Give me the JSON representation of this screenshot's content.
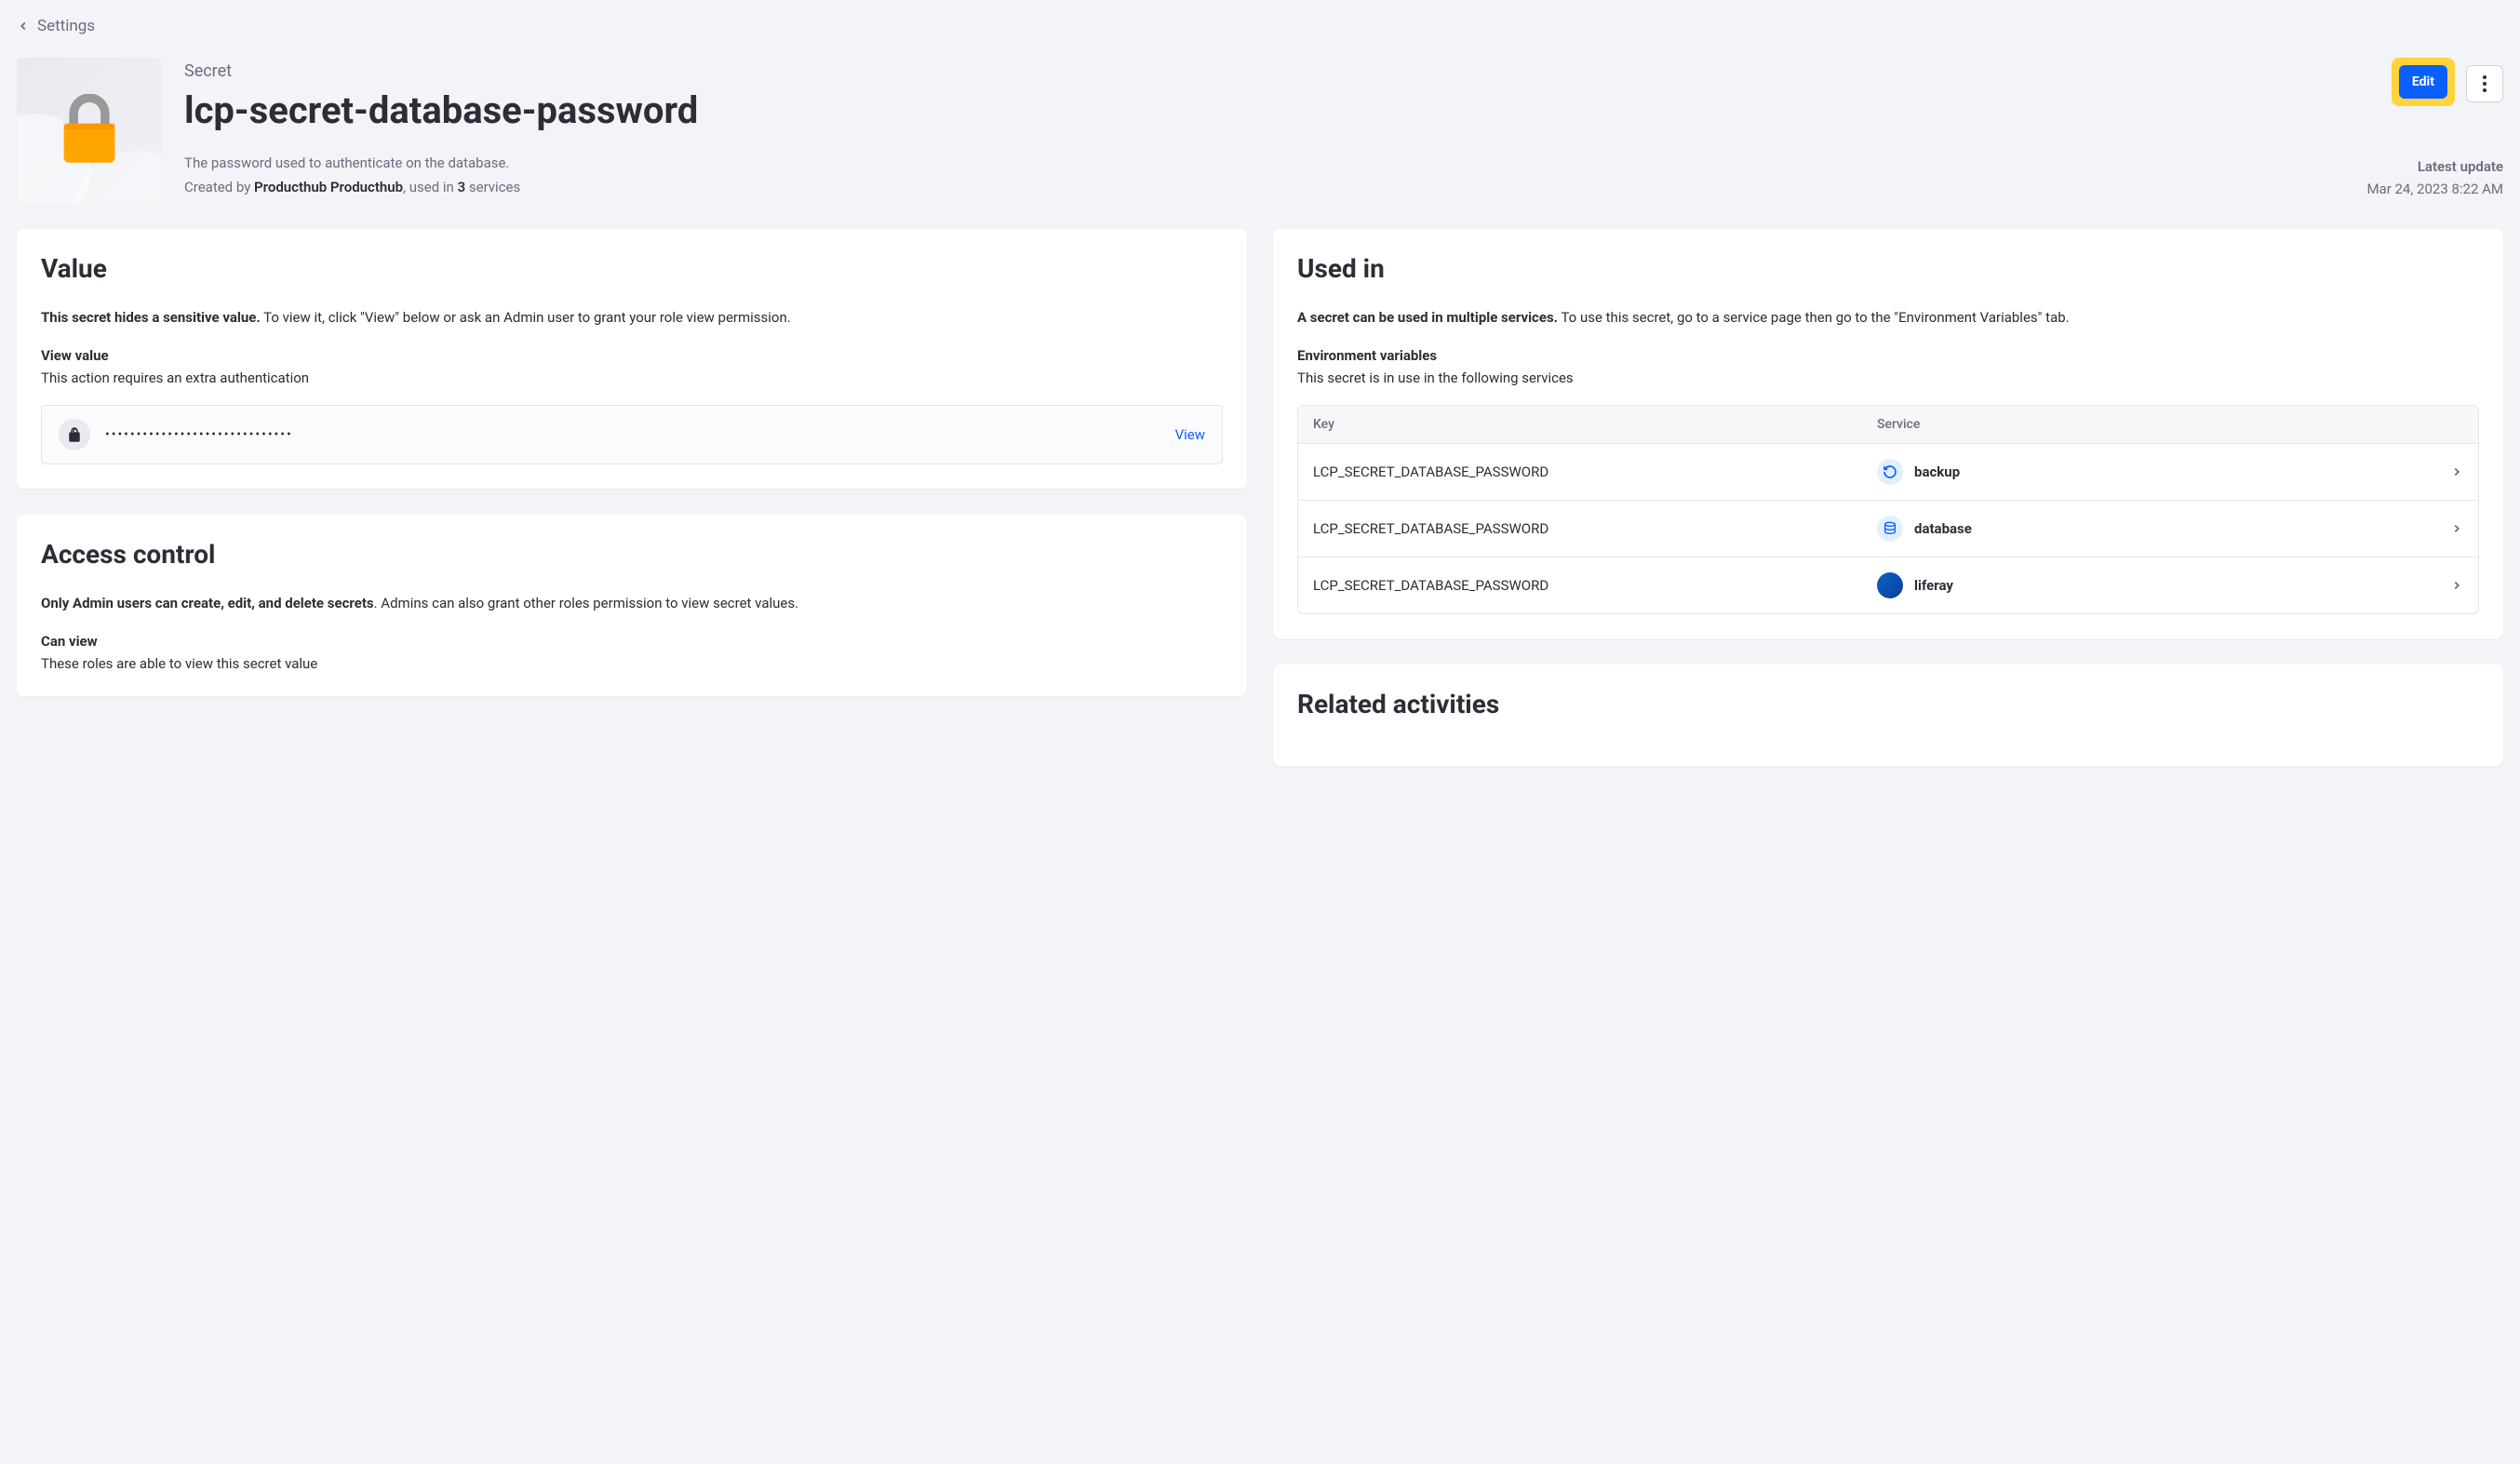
{
  "breadcrumb": {
    "label": "Settings"
  },
  "header": {
    "eyebrow": "Secret",
    "title": "lcp-secret-database-password",
    "description": "The password used to authenticate on the database.",
    "created_prefix": "Created by ",
    "created_author": "Producthub Producthub",
    "created_mid": ", used in ",
    "created_count": "3",
    "created_suffix": " services",
    "edit_label": "Edit",
    "latest_label": "Latest update",
    "latest_date": "Mar 24, 2023 8:22 AM"
  },
  "value_card": {
    "heading": "Value",
    "desc_strong": "This secret hides a sensitive value.",
    "desc_rest": " To view it, click \"View\" below or ask an Admin user to grant your role view permission.",
    "sub_heading": "View value",
    "sub_text": "This action requires an extra authentication",
    "masked": "••••••••••••••••••••••••••••••",
    "view_label": "View"
  },
  "access_card": {
    "heading": "Access control",
    "desc_strong": "Only Admin users can create, edit, and delete secrets",
    "desc_rest": ". Admins can also grant other roles permission to view secret values.",
    "sub_heading": "Can view",
    "sub_text": "These roles are able to view this secret value"
  },
  "used_card": {
    "heading": "Used in",
    "desc_strong": "A secret can be used in multiple services.",
    "desc_rest": " To use this secret, go to a service page then go to the \"Environment Variables\" tab.",
    "sub_heading": "Environment variables",
    "sub_text": "This secret is in use in the following services",
    "th_key": "Key",
    "th_service": "Service",
    "rows": [
      {
        "key": "LCP_SECRET_DATABASE_PASSWORD",
        "service": "backup",
        "icon": "backup"
      },
      {
        "key": "LCP_SECRET_DATABASE_PASSWORD",
        "service": "database",
        "icon": "database"
      },
      {
        "key": "LCP_SECRET_DATABASE_PASSWORD",
        "service": "liferay",
        "icon": "liferay"
      }
    ]
  },
  "activities_card": {
    "heading": "Related activities"
  }
}
